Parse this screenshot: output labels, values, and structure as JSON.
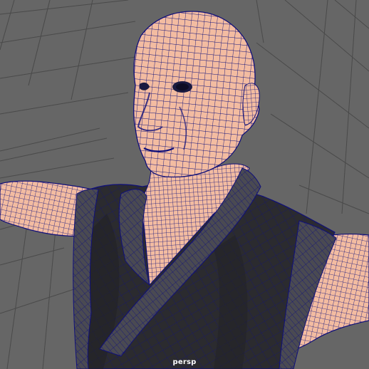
{
  "viewport": {
    "camera_name": "persp",
    "background_color": "#666666",
    "grid_color": "#4a4a4a",
    "display_mode": "wireframe-on-shaded"
  },
  "model": {
    "skin_color": "#f3bca1",
    "wire_color": "#10107a",
    "robe_color": "#2b2b2f",
    "robe_trim_color": "#4a4a52"
  },
  "icons": [
    "grid-floor",
    "character-mesh"
  ]
}
